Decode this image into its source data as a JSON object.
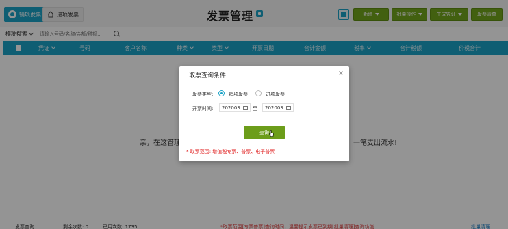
{
  "tabs": [
    {
      "label": "销项发票"
    },
    {
      "label": "进项发票"
    }
  ],
  "header": {
    "title": "发票管理",
    "buttons": [
      {
        "label": "新增"
      },
      {
        "label": "批量操作"
      },
      {
        "label": "生成凭证"
      },
      {
        "label": "发票清单"
      }
    ]
  },
  "search": {
    "mode_label": "模糊搜索",
    "placeholder": "请输入号码/名称/金额/税额..."
  },
  "table": {
    "columns": [
      {
        "label": "凭证"
      },
      {
        "label": "号码"
      },
      {
        "label": "客户名称"
      },
      {
        "label": "种类"
      },
      {
        "label": "类型"
      },
      {
        "label": "开票日期"
      },
      {
        "label": "合计金额"
      },
      {
        "label": "税率"
      },
      {
        "label": "合计税额"
      },
      {
        "label": "价税合计"
      }
    ],
    "empty_left": "亲，在这管理",
    "empty_right": "一笔支出流水!"
  },
  "dialog": {
    "title": "取票查询条件",
    "close": "×",
    "type_label": "发票类型:",
    "options": [
      {
        "label": "销项发票",
        "selected": true
      },
      {
        "label": "进项发票",
        "selected": false
      }
    ],
    "date_label": "开票时间:",
    "date_from": "202003",
    "date_sep": "至",
    "date_to": "202003",
    "query_button": "查询",
    "scope_note": "* 取票范围: 增值税专票、普票、电子普票"
  },
  "footer": {
    "item1": "发票查询",
    "item2": "剩余次数: 0",
    "item3": "已用次数: 1735",
    "notice": "*取票范围[专票普票]查询时间，温馨提示发票已到期[批量清理]查询功能",
    "right": "批量清理"
  },
  "colors": {
    "accent": "#1aa2c6",
    "button_green": "#73a61d",
    "warning_red": "#e02020"
  }
}
